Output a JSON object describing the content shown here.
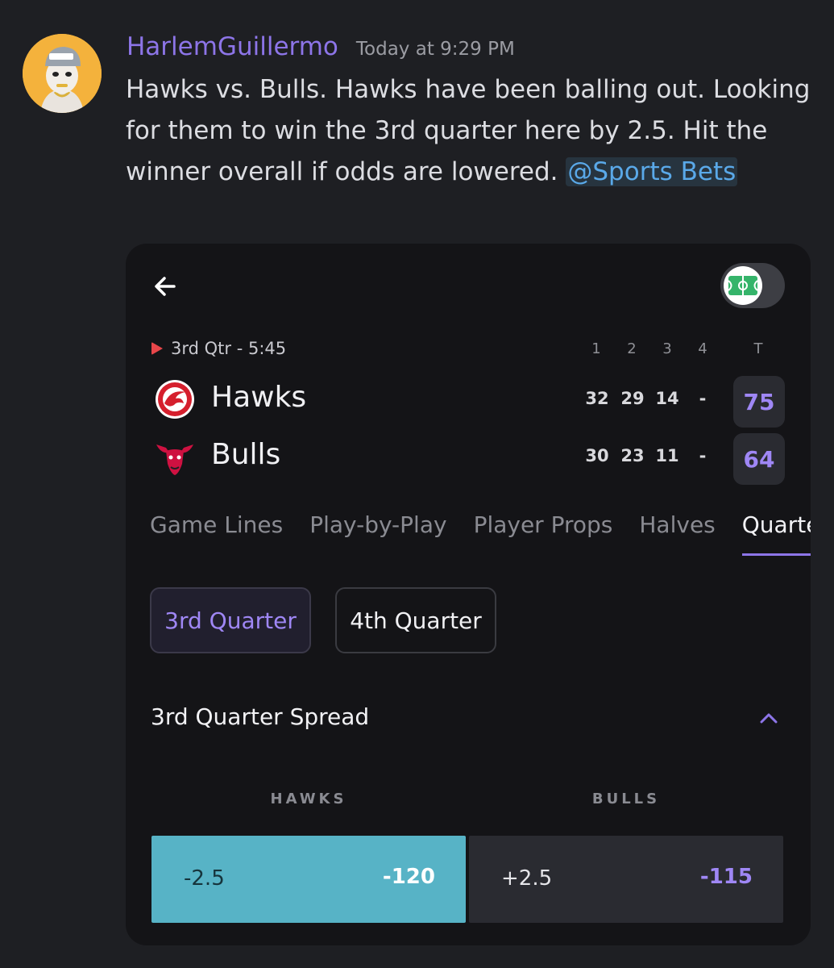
{
  "message": {
    "username": "HarlemGuillermo",
    "timestamp": "Today at 9:29 PM",
    "text": "Hawks vs. Bulls. Hawks have been balling out. Looking for them to win the 3rd quarter here by 2.5. Hit the winner overall if odds are lowered. ",
    "mention": "@Sports Bets"
  },
  "game": {
    "period": "3rd Qtr - 5:45",
    "quarter_headers": [
      "1",
      "2",
      "3",
      "4",
      "T"
    ],
    "teams": [
      {
        "name": "Hawks",
        "scores": [
          "32",
          "29",
          "14",
          "-"
        ],
        "total": "75",
        "logo": "hawks-logo-icon"
      },
      {
        "name": "Bulls",
        "scores": [
          "30",
          "23",
          "11",
          "-"
        ],
        "total": "64",
        "logo": "bulls-logo-icon"
      }
    ]
  },
  "tabs": [
    "Game Lines",
    "Play-by-Play",
    "Player Props",
    "Halves",
    "Quarters"
  ],
  "active_tab": "Quarters",
  "quarter_chips": [
    "3rd Quarter",
    "4th Quarter"
  ],
  "market": {
    "title": "3rd Quarter Spread",
    "columns": [
      "HAWKS",
      "BULLS"
    ],
    "odds": [
      {
        "line": "-2.5",
        "price": "-120",
        "selected": true
      },
      {
        "line": "+2.5",
        "price": "-115",
        "selected": false
      }
    ]
  },
  "colors": {
    "accent": "#8d75e8",
    "selected": "#57b3c6",
    "live": "#e8464a",
    "mention": "#5aa9e9"
  }
}
